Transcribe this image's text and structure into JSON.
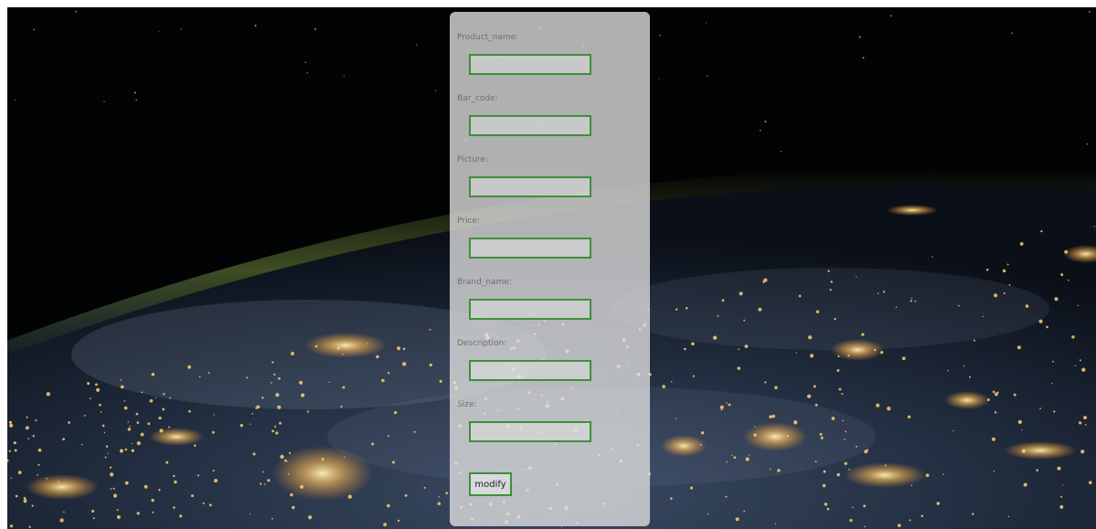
{
  "form": {
    "fields": [
      {
        "label": "Product_name:",
        "value": "",
        "placeholder": ""
      },
      {
        "label": "Bar_code:",
        "value": "",
        "placeholder": ""
      },
      {
        "label": "Picture:",
        "value": "",
        "placeholder": ""
      },
      {
        "label": "Price:",
        "value": "",
        "placeholder": ""
      },
      {
        "label": "Brand_name:",
        "value": "",
        "placeholder": ""
      },
      {
        "label": "Description:",
        "value": "",
        "placeholder": ""
      },
      {
        "label": "Size:",
        "value": "",
        "placeholder": ""
      }
    ],
    "submit_label": "modify"
  },
  "colors": {
    "field_border": "#3f8f3a",
    "panel_background": "#e1e1e1",
    "label_text": "#6f6f6f",
    "city_lights": "#ffcc66"
  }
}
